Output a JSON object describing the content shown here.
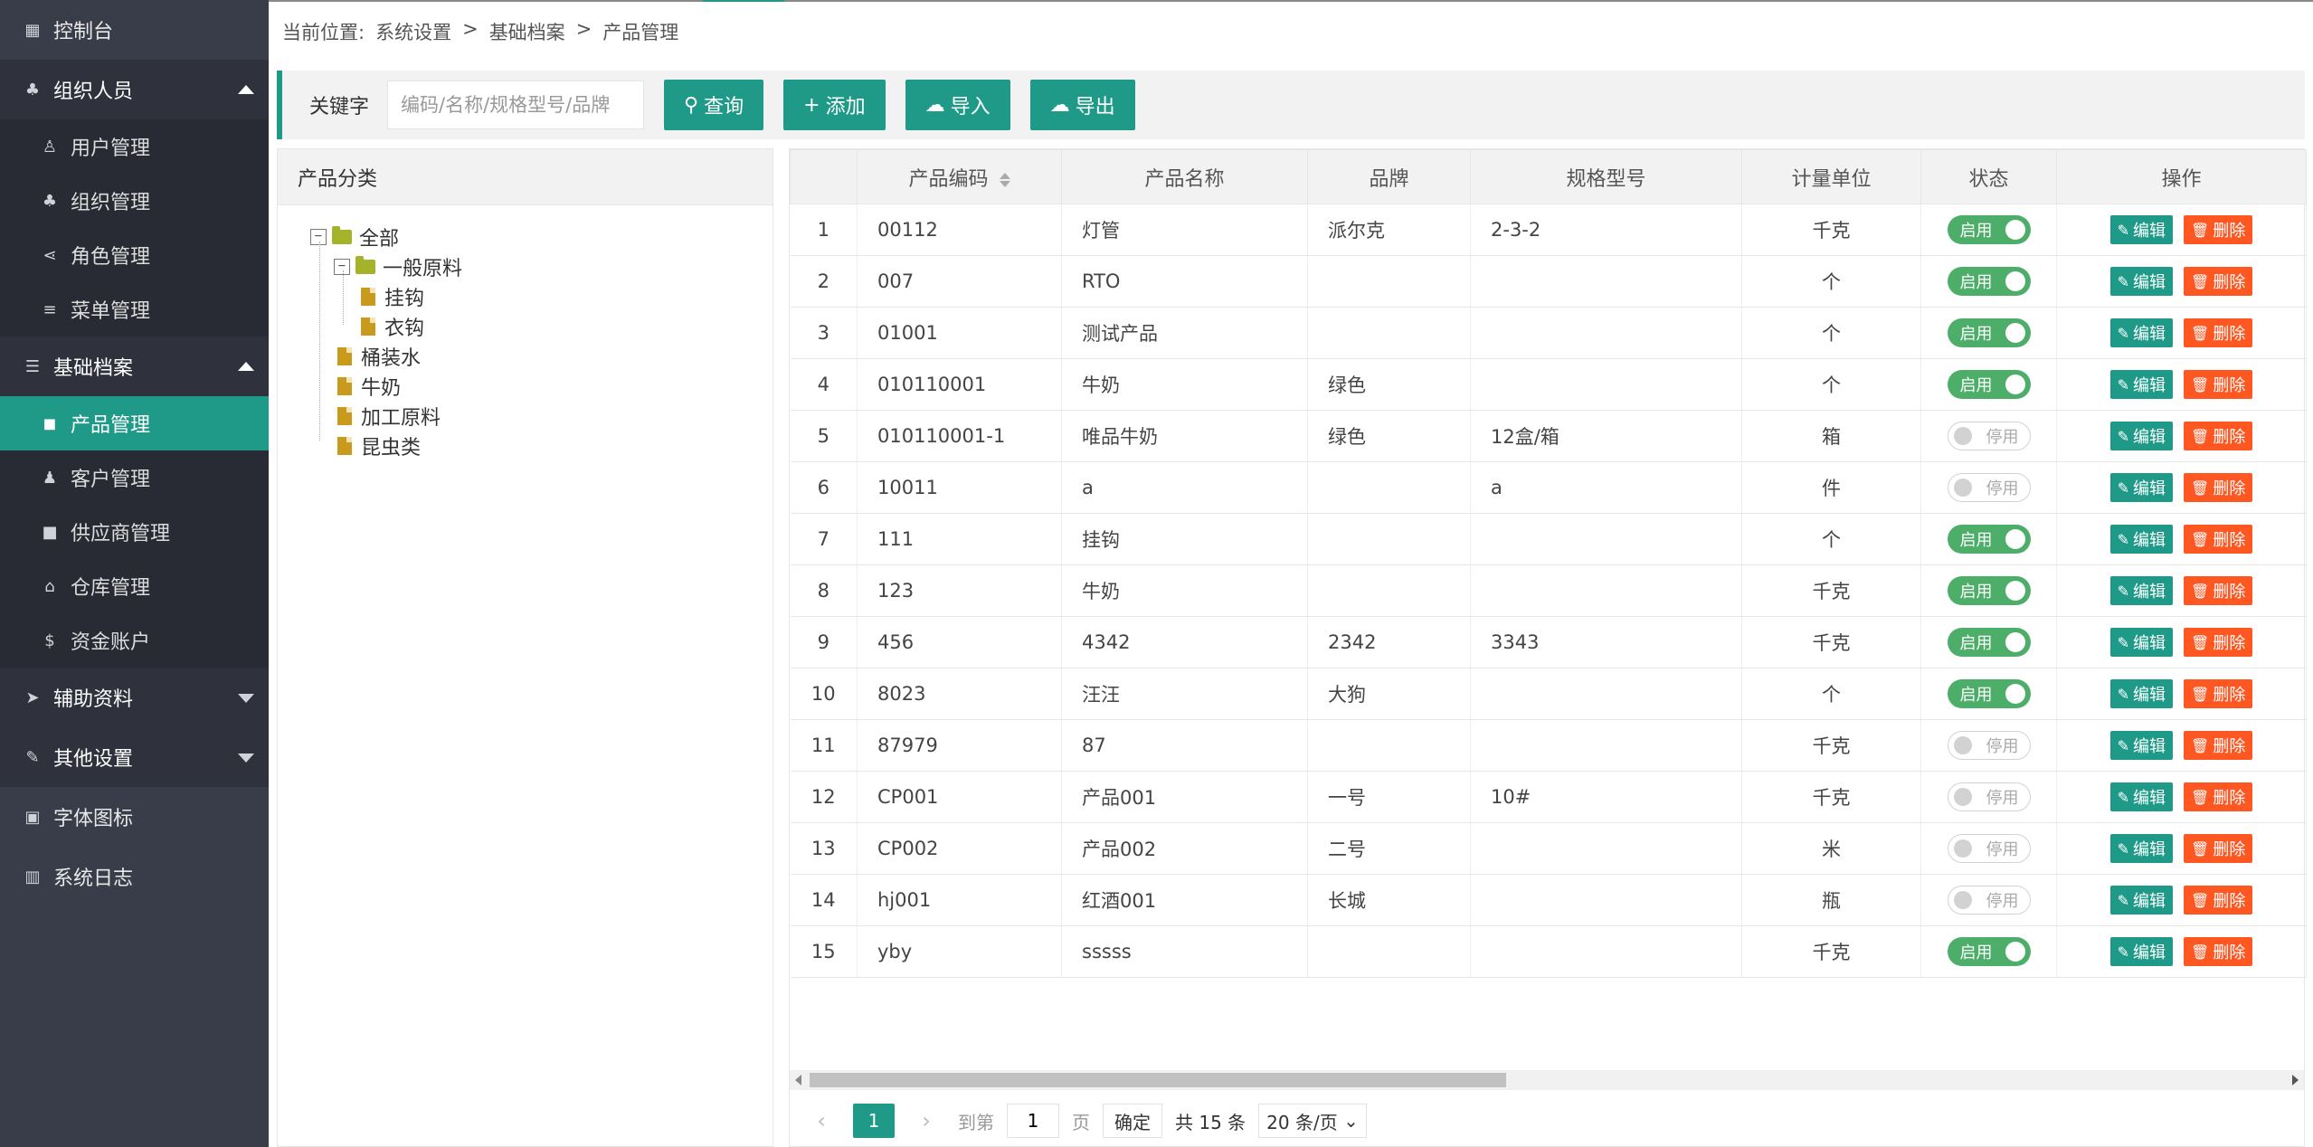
{
  "sidebar": {
    "items": [
      {
        "label": "控制台",
        "icon": "dashboard-icon",
        "type": "top"
      },
      {
        "label": "组织人员",
        "icon": "org-icon",
        "type": "group",
        "expanded": true
      },
      {
        "label": "用户管理",
        "icon": "user-icon",
        "type": "sub"
      },
      {
        "label": "组织管理",
        "icon": "org-icon",
        "type": "sub"
      },
      {
        "label": "角色管理",
        "icon": "share-icon",
        "type": "sub"
      },
      {
        "label": "菜单管理",
        "icon": "menu-icon",
        "type": "sub"
      },
      {
        "label": "基础档案",
        "icon": "list-icon",
        "type": "group",
        "expanded": true
      },
      {
        "label": "产品管理",
        "icon": "bag-icon",
        "type": "sub",
        "active": true
      },
      {
        "label": "客户管理",
        "icon": "user-add-icon",
        "type": "sub"
      },
      {
        "label": "供应商管理",
        "icon": "truck-icon",
        "type": "sub"
      },
      {
        "label": "仓库管理",
        "icon": "home-icon",
        "type": "sub"
      },
      {
        "label": "资金账户",
        "icon": "dollar-icon",
        "type": "sub"
      },
      {
        "label": "辅助资料",
        "icon": "send-icon",
        "type": "group",
        "expanded": false
      },
      {
        "label": "其他设置",
        "icon": "edit-icon",
        "type": "group",
        "expanded": false
      },
      {
        "label": "字体图标",
        "icon": "image-icon",
        "type": "top"
      },
      {
        "label": "系统日志",
        "icon": "grid-icon",
        "type": "top"
      }
    ]
  },
  "breadcrumb": {
    "prefix": "当前位置:",
    "items": [
      "系统设置",
      "基础档案",
      "产品管理"
    ],
    "sep": ">"
  },
  "search": {
    "label": "关键字",
    "placeholder": "编码/名称/规格型号/品牌",
    "buttons": {
      "query": "查询",
      "add": "添加",
      "import": "导入",
      "export": "导出"
    }
  },
  "category": {
    "title": "产品分类",
    "nodes": [
      {
        "label": "全部",
        "kind": "folder-open",
        "toggle": "−"
      },
      {
        "label": "一般原料",
        "kind": "folder-open",
        "toggle": "−"
      },
      {
        "label": "挂钩",
        "kind": "file"
      },
      {
        "label": "衣钩",
        "kind": "file"
      },
      {
        "label": "桶装水",
        "kind": "file"
      },
      {
        "label": "牛奶",
        "kind": "file"
      },
      {
        "label": "加工原料",
        "kind": "file"
      },
      {
        "label": "昆虫类",
        "kind": "file"
      }
    ]
  },
  "table": {
    "headers": [
      "",
      "产品编码",
      "产品名称",
      "品牌",
      "规格型号",
      "计量单位",
      "状态",
      "操作"
    ],
    "status_on": "启用",
    "status_off": "停用",
    "edit_label": "编辑",
    "delete_label": "删除",
    "rows": [
      {
        "n": "1",
        "code": "00112",
        "name": "灯管",
        "brand": "派尔克",
        "spec": "2-3-2",
        "unit": "千克",
        "on": true
      },
      {
        "n": "2",
        "code": "007",
        "name": "RTO",
        "brand": "",
        "spec": "",
        "unit": "个",
        "on": true
      },
      {
        "n": "3",
        "code": "01001",
        "name": "测试产品",
        "brand": "",
        "spec": "",
        "unit": "个",
        "on": true
      },
      {
        "n": "4",
        "code": "010110001",
        "name": "牛奶",
        "brand": "绿色",
        "spec": "",
        "unit": "个",
        "on": true
      },
      {
        "n": "5",
        "code": "010110001-1",
        "name": "唯品牛奶",
        "brand": "绿色",
        "spec": "12盒/箱",
        "unit": "箱",
        "on": false
      },
      {
        "n": "6",
        "code": "10011",
        "name": "a",
        "brand": "",
        "spec": "a",
        "unit": "件",
        "on": false
      },
      {
        "n": "7",
        "code": "111",
        "name": "挂钩",
        "brand": "",
        "spec": "",
        "unit": "个",
        "on": true
      },
      {
        "n": "8",
        "code": "123",
        "name": "牛奶",
        "brand": "",
        "spec": "",
        "unit": "千克",
        "on": true
      },
      {
        "n": "9",
        "code": "456",
        "name": "4342",
        "brand": "2342",
        "spec": "3343",
        "unit": "千克",
        "on": true
      },
      {
        "n": "10",
        "code": "8023",
        "name": "汪汪",
        "brand": "大狗",
        "spec": "",
        "unit": "个",
        "on": true
      },
      {
        "n": "11",
        "code": "87979",
        "name": "87",
        "brand": "",
        "spec": "",
        "unit": "千克",
        "on": false
      },
      {
        "n": "12",
        "code": "CP001",
        "name": "产品001",
        "brand": "一号",
        "spec": "10#",
        "unit": "千克",
        "on": false
      },
      {
        "n": "13",
        "code": "CP002",
        "name": "产品002",
        "brand": "二号",
        "spec": "",
        "unit": "米",
        "on": false
      },
      {
        "n": "14",
        "code": "hj001",
        "name": "红酒001",
        "brand": "长城",
        "spec": "",
        "unit": "瓶",
        "on": false
      },
      {
        "n": "15",
        "code": "yby",
        "name": "sssss",
        "brand": "",
        "spec": "",
        "unit": "千克",
        "on": true
      }
    ]
  },
  "pager": {
    "current": "1",
    "goto_label": "到第",
    "goto_value": "1",
    "page_label": "页",
    "confirm": "确定",
    "total": "共 15 条",
    "page_size": "20 条/页"
  },
  "colors": {
    "accent": "#1f9a89",
    "sidebar": "#393d49",
    "on": "#4cae69",
    "delete": "#ff5722"
  }
}
